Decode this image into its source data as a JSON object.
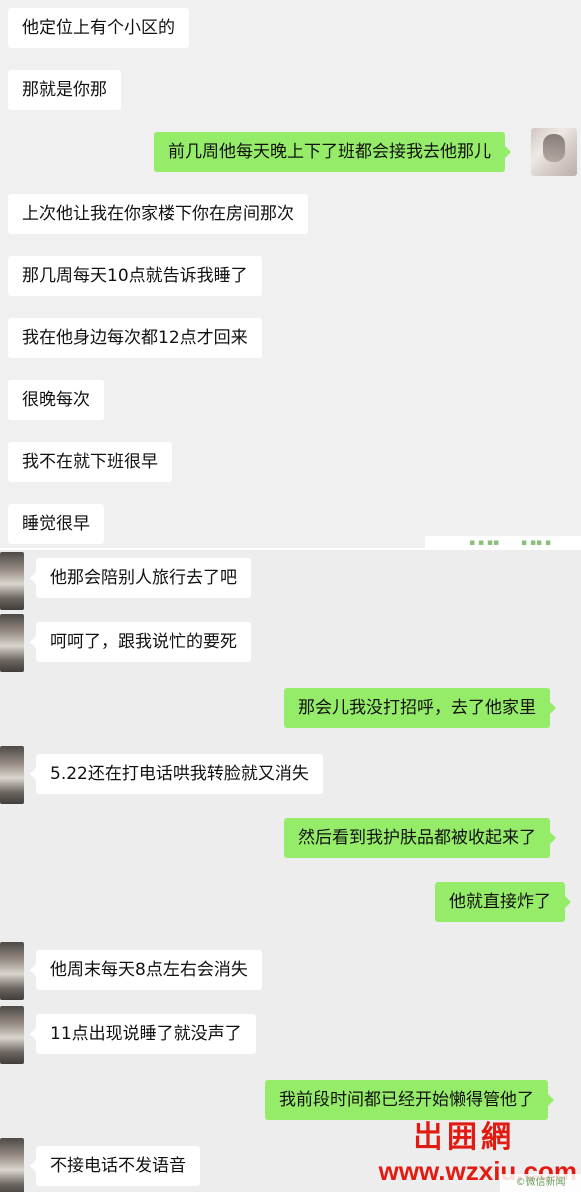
{
  "top_section": {
    "messages": [
      {
        "side": "in",
        "text": "他定位上有个小区的"
      },
      {
        "side": "in",
        "text": "那就是你那"
      },
      {
        "side": "out",
        "text": "前几周他每天晚上下了班都会接我去他那儿"
      },
      {
        "side": "in",
        "text": "上次他让我在你家楼下你在房间那次"
      },
      {
        "side": "in",
        "text": "那几周每天10点就告诉我睡了"
      },
      {
        "side": "in",
        "text": "我在他身边每次都12点才回来"
      },
      {
        "side": "in",
        "text": "很晚每次"
      },
      {
        "side": "in",
        "text": "我不在就下班很早"
      },
      {
        "side": "in",
        "text": "睡觉很早"
      }
    ]
  },
  "bottom_section": {
    "messages": [
      {
        "side": "in",
        "text": "他那会陪别人旅行去了吧"
      },
      {
        "side": "in",
        "text": "呵呵了，跟我说忙的要死"
      },
      {
        "side": "out",
        "text": "那会儿我没打招呼，去了他家里"
      },
      {
        "side": "in",
        "text": "5.22还在打电话哄我转脸就又消失"
      },
      {
        "side": "out",
        "text": "然后看到我护肤品都被收起来了"
      },
      {
        "side": "out",
        "text": "他就直接炸了"
      },
      {
        "side": "in",
        "text": "他周末每天8点左右会消失"
      },
      {
        "side": "in",
        "text": "11点出现说睡了就没声了"
      },
      {
        "side": "out",
        "text": "我前段时间都已经开始懒得管他了"
      },
      {
        "side": "in",
        "text": "不接电话不发语音"
      }
    ]
  },
  "watermark": {
    "logo_text": "岀囲網",
    "url": "www.wzxiu.com",
    "corner_text": "©微信新闻"
  },
  "colors": {
    "outgoing_bubble": "#95ec69",
    "incoming_bubble": "#ffffff",
    "background": "#efefef",
    "watermark": "#e21b12"
  }
}
